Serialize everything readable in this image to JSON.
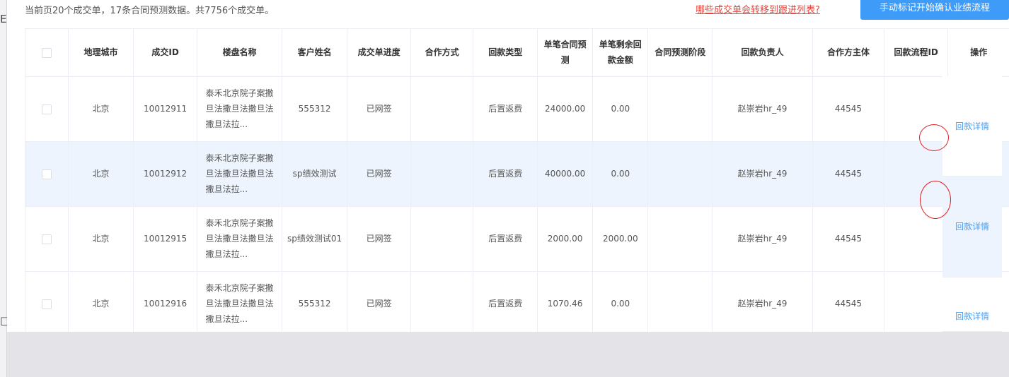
{
  "summary": "当前页20个成交单，17条合同预测数据。共7756个成交单。",
  "transfer_link": "哪些成交单会转移到跟进列表?",
  "start_button": "手动标记开始确认业绩流程",
  "columns": [
    "地理城市",
    "成交ID",
    "楼盘名称",
    "客户姓名",
    "成交单进度",
    "合作方式",
    "回款类型",
    "单笔合同预测",
    "单笔剩余回款金额",
    "合同预测阶段",
    "回款负责人",
    "合作方主体",
    "回款流程ID",
    "操作"
  ],
  "rows": [
    {
      "city": "北京",
      "deal_id": "10012911",
      "building": "泰禾北京院子案撒旦法撒旦法撒旦法撒旦法拉...",
      "customer": "555312",
      "progress": "已网签",
      "coop_mode": "",
      "payment_type": "后置返费",
      "forecast": "24000.00",
      "remaining": "0.00",
      "stage": "",
      "owner": "赵崇岩hr_49",
      "partner": "44545",
      "flow_id": ""
    },
    {
      "city": "北京",
      "deal_id": "10012912",
      "building": "泰禾北京院子案撒旦法撒旦法撒旦法撒旦法拉...",
      "customer": "sp绩效测试",
      "progress": "已网签",
      "coop_mode": "",
      "payment_type": "后置返费",
      "forecast": "40000.00",
      "remaining": "0.00",
      "stage": "",
      "owner": "赵崇岩hr_49",
      "partner": "44545",
      "flow_id": ""
    },
    {
      "city": "北京",
      "deal_id": "10012915",
      "building": "泰禾北京院子案撒旦法撒旦法撒旦法撒旦法拉...",
      "customer": "sp绩效测试01",
      "progress": "已网签",
      "coop_mode": "",
      "payment_type": "后置返费",
      "forecast": "2000.00",
      "remaining": "2000.00",
      "stage": "",
      "owner": "赵崇岩hr_49",
      "partner": "44545",
      "flow_id": ""
    },
    {
      "city": "北京",
      "deal_id": "10012916",
      "building": "泰禾北京院子案撒旦法撒旦法撒旦法撒旦法拉...",
      "customer": "555312",
      "progress": "已网签",
      "coop_mode": "",
      "payment_type": "后置返费",
      "forecast": "1070.46",
      "remaining": "0.00",
      "stage": "",
      "owner": "赵崇岩hr_49",
      "partner": "44545",
      "flow_id": ""
    }
  ],
  "action_label": "回款详情",
  "colors": {
    "primary": "#3e9bf7",
    "link": "#4a9ff0",
    "warning_link": "#e8463c",
    "row_highlight": "#edf4fd",
    "annotation": "#e02020"
  }
}
